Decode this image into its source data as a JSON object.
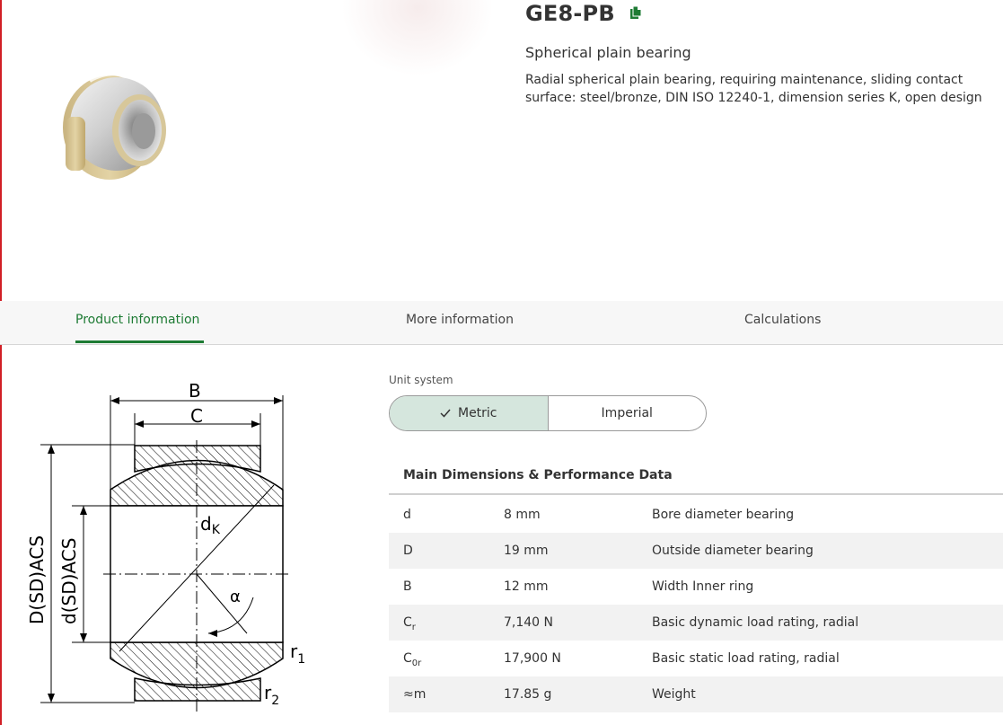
{
  "product": {
    "title": "GE8-PB",
    "subtitle": "Spherical plain bearing",
    "description": "Radial spherical plain bearing, requiring maintenance, sliding contact surface: steel/bronze, DIN ISO 12240-1, dimension series K, open design",
    "copy_icon": "copy-icon"
  },
  "tabs": [
    {
      "label": "Product information",
      "active": true
    },
    {
      "label": "More information",
      "active": false
    },
    {
      "label": "Calculations",
      "active": false
    }
  ],
  "diagram": {
    "labels": {
      "B": "B",
      "C": "C",
      "dK": "d",
      "dK_sub": "K",
      "alpha": "α",
      "r1": "r",
      "r1_sub": "1",
      "r2": "r",
      "r2_sub": "2",
      "D_acs": "D(SD)ACS",
      "d_acs": "d(SD)ACS"
    }
  },
  "unit_system": {
    "label": "Unit system",
    "options": [
      {
        "label": "Metric",
        "selected": true
      },
      {
        "label": "Imperial",
        "selected": false
      }
    ]
  },
  "dimensions": {
    "title": "Main Dimensions & Performance Data",
    "rows": [
      {
        "symbol": "d",
        "value": "8 mm",
        "description": "Bore diameter bearing"
      },
      {
        "symbol": "D",
        "value": "19 mm",
        "description": "Outside diameter bearing"
      },
      {
        "symbol": "B",
        "value": "12 mm",
        "description": "Width Inner ring"
      },
      {
        "symbol": "C",
        "symbol_sub": "r",
        "value": "7,140 N",
        "description": "Basic dynamic load rating, radial"
      },
      {
        "symbol": "C",
        "symbol_sub": "0r",
        "value": "17,900 N",
        "description": "Basic static load rating, radial"
      },
      {
        "symbol": "≈m",
        "value": "17.85 g",
        "description": "Weight"
      }
    ]
  },
  "colors": {
    "accent": "#1e7b34",
    "brand_red": "#d11f26",
    "toggle_selected": "#d5e6dd"
  }
}
